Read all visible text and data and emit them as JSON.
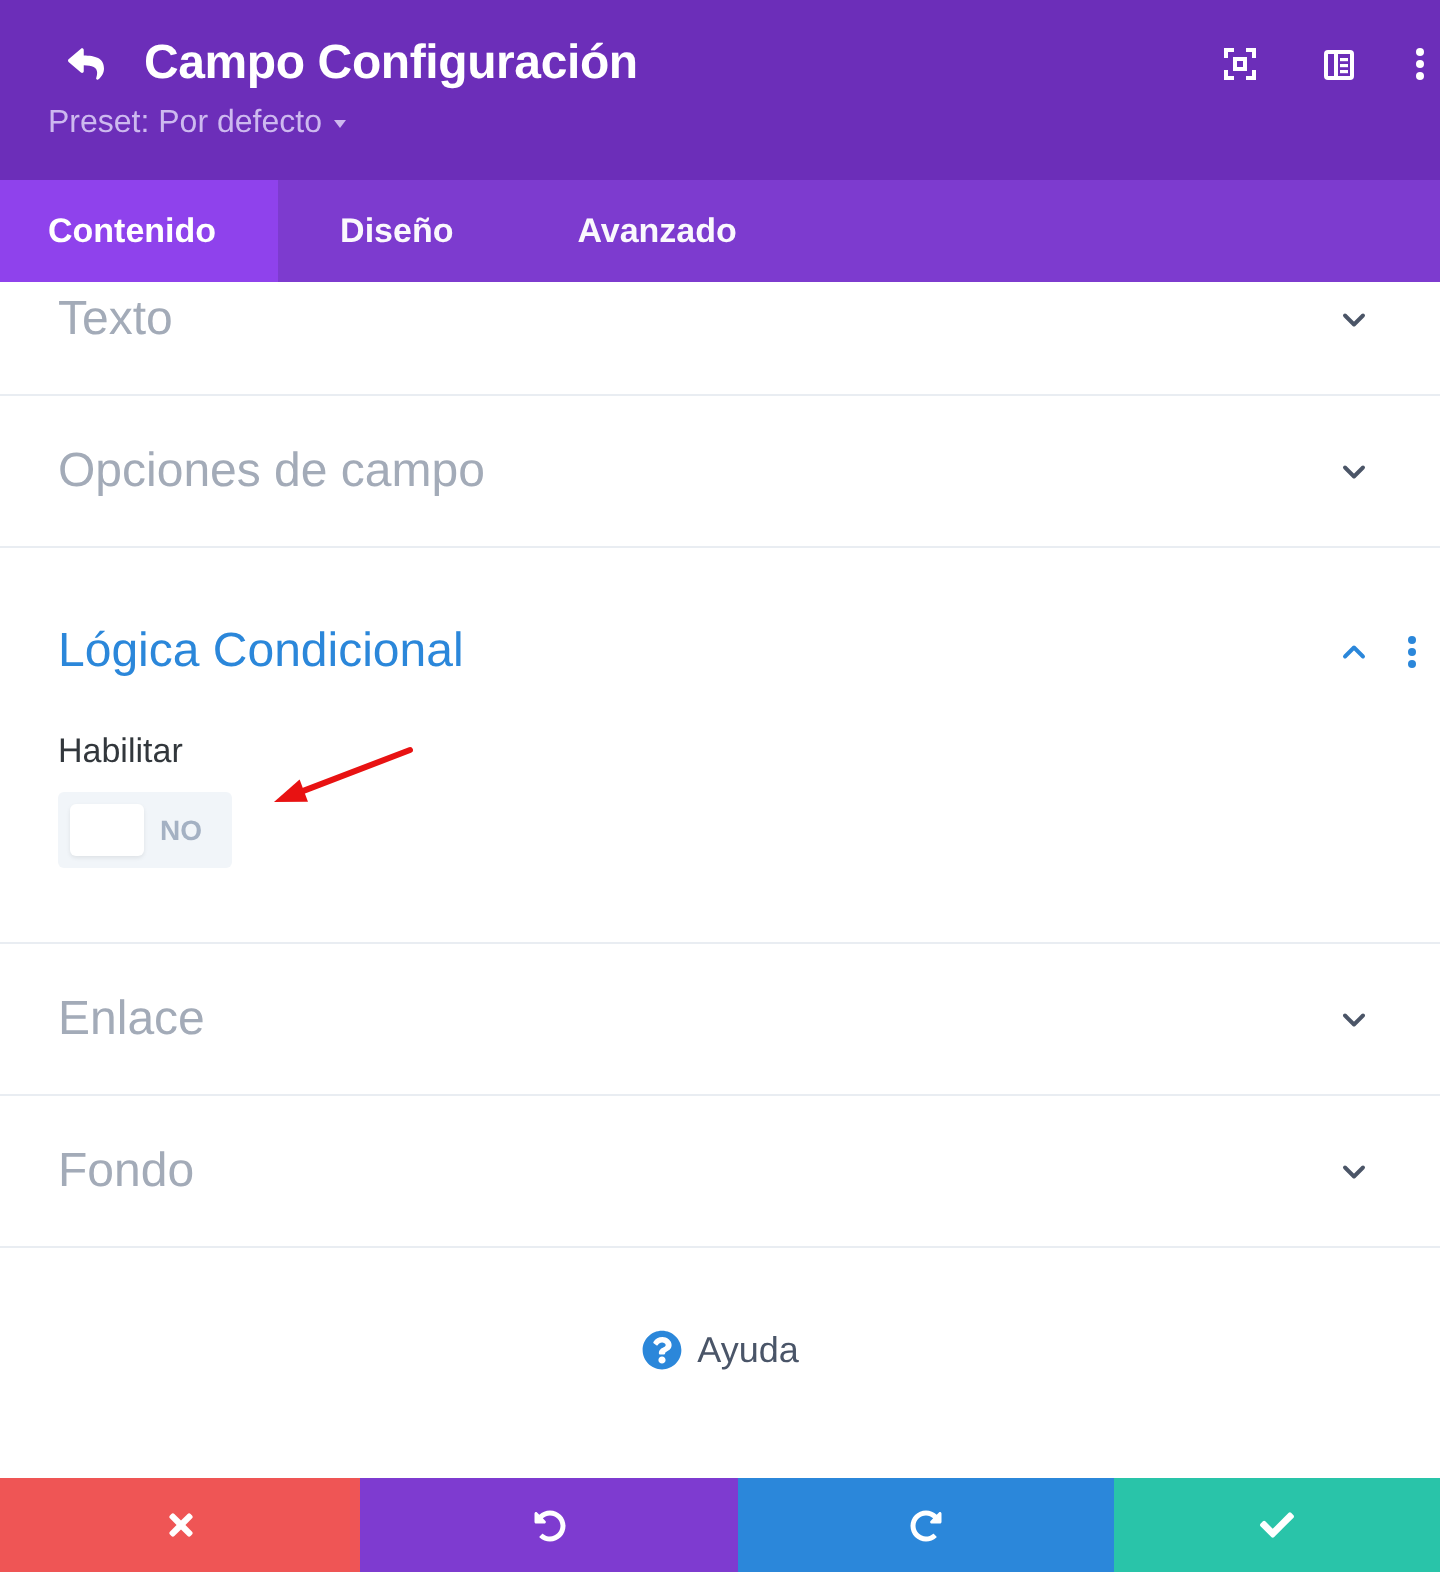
{
  "header": {
    "title": "Campo Configuración",
    "preset": "Preset: Por defecto"
  },
  "tabs": [
    {
      "label": "Contenido",
      "selected": true
    },
    {
      "label": "Diseño",
      "selected": false
    },
    {
      "label": "Avanzado",
      "selected": false
    }
  ],
  "sections": [
    {
      "title": "Texto",
      "expanded": false
    },
    {
      "title": "Opciones de campo",
      "expanded": false
    },
    {
      "title": "Lógica Condicional",
      "expanded": true,
      "fields": [
        {
          "kind": "toggle",
          "label": "Habilitar",
          "on": false,
          "state_text": "NO",
          "arrow_marked": true
        }
      ]
    },
    {
      "title": "Enlace",
      "expanded": false
    },
    {
      "title": "Fondo",
      "expanded": false
    }
  ],
  "help": {
    "label": "Ayuda"
  },
  "actions": [
    {
      "kind": "discard"
    },
    {
      "kind": "undo"
    },
    {
      "kind": "redo"
    },
    {
      "kind": "save"
    }
  ]
}
